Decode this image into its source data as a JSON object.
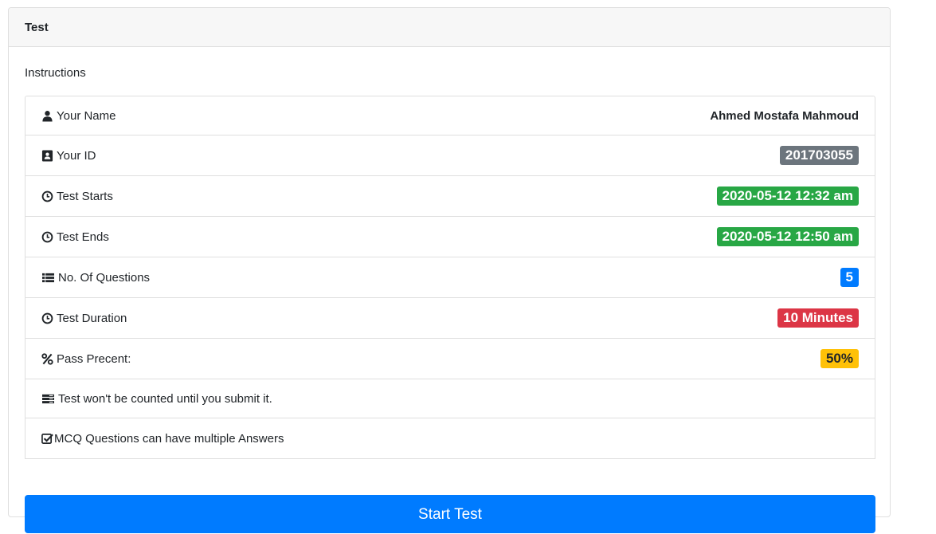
{
  "card": {
    "title": "Test",
    "instructions_label": "Instructions"
  },
  "rows": {
    "name": {
      "label": "Your Name",
      "icon": "user-icon",
      "value": "Ahmed Mostafa Mahmoud"
    },
    "id": {
      "label": "Your ID",
      "icon": "id-card-icon",
      "value": "201703055",
      "color": "#6c757d"
    },
    "starts": {
      "label": "Test Starts",
      "icon": "clock-icon",
      "value": "2020-05-12 12:32 am",
      "color": "#28a745"
    },
    "ends": {
      "label": "Test Ends",
      "icon": "clock-icon",
      "value": "2020-05-12 12:50 am",
      "color": "#28a745"
    },
    "questions": {
      "label": "No. Of Questions",
      "icon": "list-icon",
      "value": "5",
      "color": "#007bff"
    },
    "duration": {
      "label": "Test Duration",
      "icon": "clock-icon",
      "value": "10 Minutes",
      "color": "#dc3545"
    },
    "pass": {
      "label": "Pass Precent:",
      "icon": "percent-icon",
      "value": "50%",
      "color": "#ffc107"
    },
    "submit_note": {
      "label": "Test won't be counted until you submit it.",
      "icon": "tasks-icon"
    },
    "mcq_note": {
      "label": "MCQ Questions can have multiple Answers",
      "icon": "check-square-icon"
    }
  },
  "actions": {
    "start_label": "Start Test"
  },
  "colors": {
    "primary": "#007bff",
    "success": "#28a745",
    "secondary": "#6c757d",
    "danger": "#dc3545",
    "warning": "#ffc107"
  }
}
